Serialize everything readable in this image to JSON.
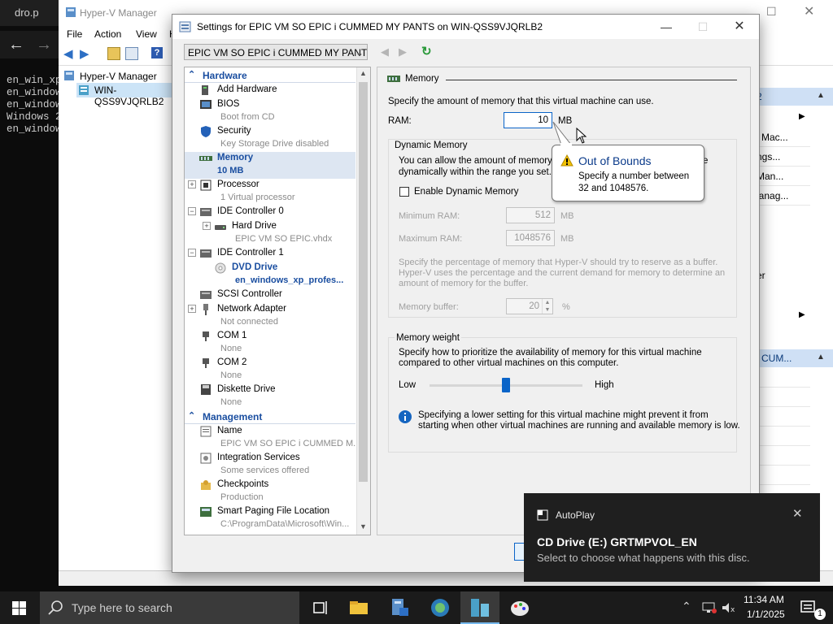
{
  "terminal": {
    "tab_title": "dro.p",
    "lines": "en_win_xp\nen_window\nen_window\nWindows 2\nen_window"
  },
  "hyperv": {
    "title": "Hyper-V Manager",
    "menu": [
      "File",
      "Action",
      "View",
      "H"
    ],
    "tree_root": "Hyper-V Manager",
    "tree_host": "WIN-QSS9VJQRLB2",
    "actions_head1": "2",
    "actions_items": [
      "l Mac...",
      "ngs...",
      "Man...",
      "lanag..."
    ],
    "actions_mid": "er",
    "actions_head2": "CUM..."
  },
  "dialog": {
    "title": "Settings for EPIC VM SO EPIC i CUMMED MY PANTS on WIN-QSS9VJQRLB2",
    "vm_select": "EPIC VM SO EPIC i CUMMED MY PANT",
    "hardware_label": "Hardware",
    "management_label": "Management",
    "hardware": [
      {
        "name": "Add Hardware",
        "sub": ""
      },
      {
        "name": "BIOS",
        "sub": "Boot from CD"
      },
      {
        "name": "Security",
        "sub": "Key Storage Drive disabled"
      },
      {
        "name": "Memory",
        "sub": "10 MB"
      },
      {
        "name": "Processor",
        "sub": "1 Virtual processor"
      },
      {
        "name": "IDE Controller 0",
        "sub": ""
      },
      {
        "name": "Hard Drive",
        "sub": "EPIC VM SO EPIC.vhdx"
      },
      {
        "name": "IDE Controller 1",
        "sub": ""
      },
      {
        "name": "DVD Drive",
        "sub": "en_windows_xp_profes..."
      },
      {
        "name": "SCSI Controller",
        "sub": ""
      },
      {
        "name": "Network Adapter",
        "sub": "Not connected"
      },
      {
        "name": "COM 1",
        "sub": "None"
      },
      {
        "name": "COM 2",
        "sub": "None"
      },
      {
        "name": "Diskette Drive",
        "sub": "None"
      }
    ],
    "management": [
      {
        "name": "Name",
        "sub": "EPIC VM SO EPIC i CUMMED M..."
      },
      {
        "name": "Integration Services",
        "sub": "Some services offered"
      },
      {
        "name": "Checkpoints",
        "sub": "Production"
      },
      {
        "name": "Smart Paging File Location",
        "sub": "C:\\ProgramData\\Microsoft\\Win..."
      }
    ]
  },
  "memory": {
    "section_title": "Memory",
    "intro": "Specify the amount of memory that this virtual machine can use.",
    "ram_label": "RAM:",
    "ram_value": "10",
    "mb_unit": "MB",
    "dyn_title": "Dynamic Memory",
    "dyn_text1": "You can allow the amount of memory a",
    "dyn_text1b": "e",
    "dyn_text2": "dynamically within the range you set.",
    "enable_dyn": "Enable Dynamic Memory",
    "min_label": "Minimum RAM:",
    "min_value": "512",
    "max_label": "Maximum RAM:",
    "max_value": "1048576",
    "buffer_desc1": "Specify the percentage of memory that Hyper-V should try to reserve as a buffer.",
    "buffer_desc2": "Hyper-V uses the percentage and the current demand for memory to determine an",
    "buffer_desc3": "amount of memory for the buffer.",
    "buffer_label": "Memory buffer:",
    "buffer_value": "20",
    "percent": "%",
    "weight_title": "Memory weight",
    "weight_desc1": "Specify how to prioritize the availability of memory for this virtual machine",
    "weight_desc2": "compared to other virtual machines on this computer.",
    "low": "Low",
    "high": "High",
    "weight_level": 0.5,
    "info1": "Specifying a lower setting for this virtual machine might prevent it from",
    "info2": "starting when other virtual machines are running and available memory is low."
  },
  "tooltip": {
    "title": "Out of Bounds",
    "body": "Specify a number between 32 and 1048576."
  },
  "autoplay": {
    "app": "AutoPlay",
    "title": "CD Drive (E:) GRTMPVOL_EN",
    "body": "Select to choose what happens with this disc."
  },
  "taskbar": {
    "search_placeholder": "Type here to search",
    "time": "11:34 AM",
    "date": "1/1/2025",
    "notif_count": "1"
  },
  "colors": {
    "accent": "#1a4ea0",
    "taskbar": "#1b1b1b",
    "autoplay": "#1f1f1f"
  }
}
